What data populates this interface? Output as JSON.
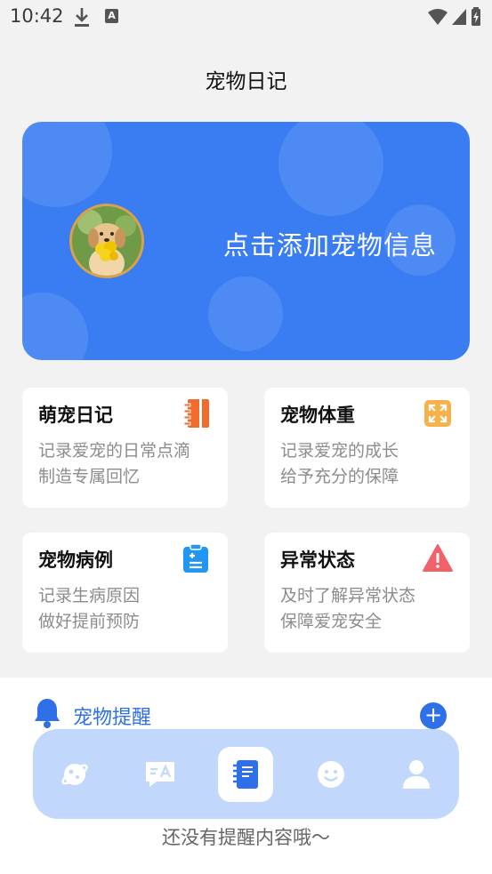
{
  "status": {
    "time": "10:42",
    "a_badge": "A"
  },
  "header": {
    "title": "宠物日记"
  },
  "banner": {
    "prompt": "点击添加宠物信息"
  },
  "cards": [
    {
      "title": "萌宠日记",
      "line1": "记录爱宠的日常点滴",
      "line2": "制造专属回忆",
      "icon": "notebook-icon",
      "color": "#f26b2c"
    },
    {
      "title": "宠物体重",
      "line1": "记录爱宠的成长",
      "line2": "给予充分的保障",
      "icon": "expand-icon",
      "color": "#f7b24a"
    },
    {
      "title": "宠物病例",
      "line1": "记录生病原因",
      "line2": "做好提前预防",
      "icon": "clipboard-icon",
      "color": "#2196f3"
    },
    {
      "title": "异常状态",
      "line1": "及时了解异常状态",
      "line2": "保障爱宠安全",
      "icon": "warning-icon",
      "color": "#f0616a"
    }
  ],
  "reminder": {
    "title": "宠物提醒",
    "add": "+",
    "empty": "还没有提醒内容哦～"
  },
  "tabbar": {
    "items": [
      "planet-icon",
      "translate-icon",
      "diary-icon",
      "smile-icon",
      "user-icon"
    ],
    "active": 2
  },
  "colors": {
    "primary": "#3a7df2",
    "accent": "#2f6fe8",
    "tabbar_bg": "#c2d7fc"
  }
}
